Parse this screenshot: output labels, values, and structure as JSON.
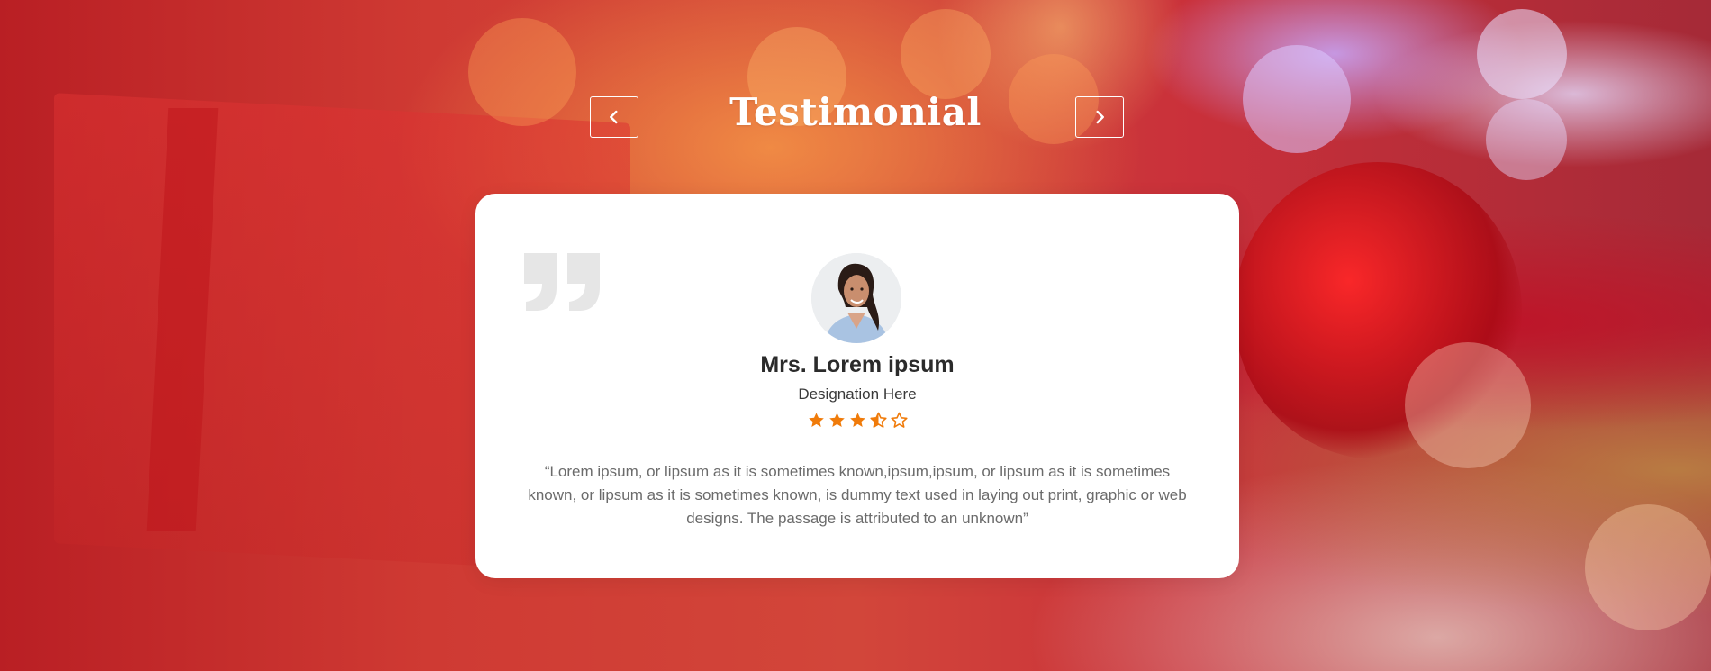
{
  "section": {
    "title": "Testimonial"
  },
  "navigation": {
    "prev_icon": "chevron-left-icon",
    "next_icon": "chevron-right-icon"
  },
  "testimonial": {
    "quote_icon": "quote-icon",
    "name": "Mrs. Lorem ipsum",
    "designation": "Designation Here",
    "rating": 3.5,
    "rating_max": 5,
    "text": "“Lorem ipsum, or lipsum as it is sometimes known,ipsum,ipsum, or lipsum as it is sometimes known, or lipsum as it is sometimes known, is dummy text used in laying out print, graphic or web designs. The passage is attributed to an unknown”"
  },
  "colors": {
    "accent_star": "#f07b0a",
    "card_background": "#ffffff",
    "title_color": "#ffffff",
    "quote_mark": "#e6e6e6"
  }
}
